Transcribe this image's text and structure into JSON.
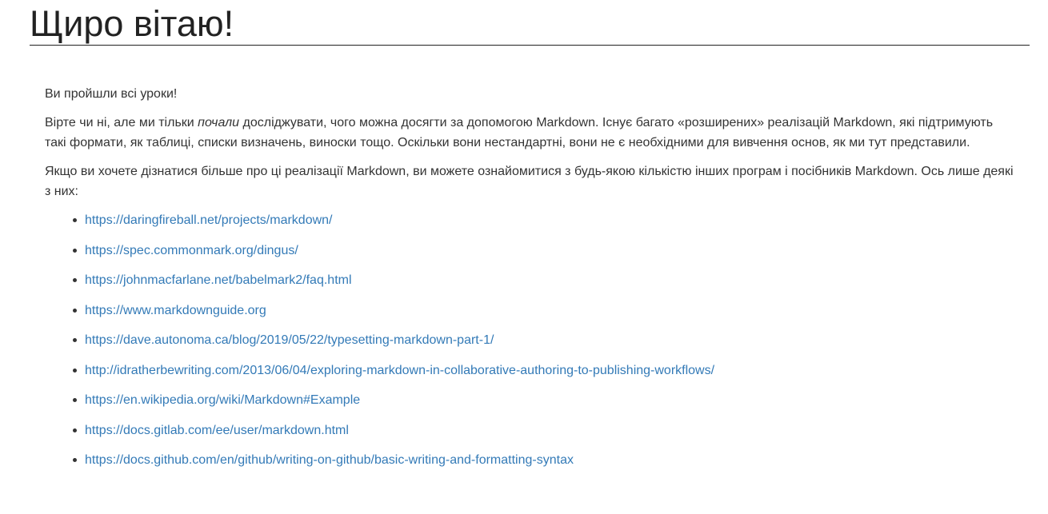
{
  "page": {
    "title": "Щиро вітаю!"
  },
  "content": {
    "p1": "Ви пройшли всі уроки!",
    "p2_before": "Вірте чи ні, але ми тільки ",
    "p2_em": "почали",
    "p2_after": " досліджувати, чого можна досягти за допомогою Markdown. Існує багато «розширених» реалізацій Markdown, які підтримують такі формати, як таблиці, списки визначень, виноски тощо. Оскільки вони нестандартні, вони не є необхідними для вивчення основ, як ми тут представили.",
    "p3": "Якщо ви хочете дізнатися більше про ці реалізації Markdown, ви можете ознайомитися з будь-якою кількістю інших програм і посібників Markdown. Ось лише деякі з них:",
    "links": [
      "https://daringfireball.net/projects/markdown/",
      "https://spec.commonmark.org/dingus/",
      "https://johnmacfarlane.net/babelmark2/faq.html",
      "https://www.markdownguide.org",
      "https://dave.autonoma.ca/blog/2019/05/22/typesetting-markdown-part-1/",
      "http://idratherbewriting.com/2013/06/04/exploring-markdown-in-collaborative-authoring-to-publishing-workflows/",
      "https://en.wikipedia.org/wiki/Markdown#Example",
      "https://docs.gitlab.com/ee/user/markdown.html",
      "https://docs.github.com/en/github/writing-on-github/basic-writing-and-formatting-syntax"
    ]
  },
  "colors": {
    "text": "#333333",
    "heading": "#222222",
    "link": "#337ab7",
    "background": "#ffffff"
  }
}
